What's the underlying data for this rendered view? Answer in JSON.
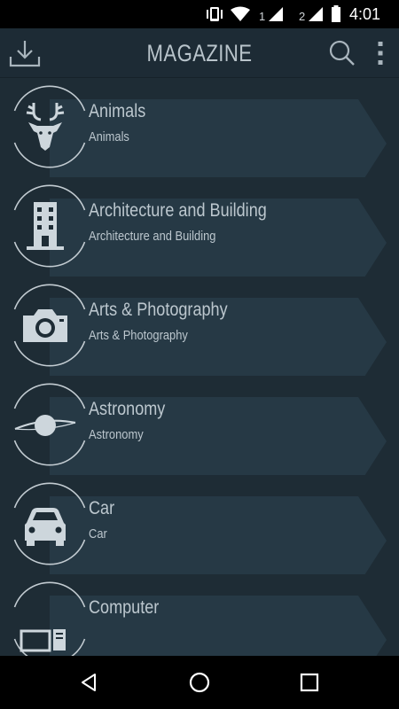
{
  "status_bar": {
    "time": "4:01",
    "sim1": "1",
    "sim2": "2",
    "icons": [
      "vibrate-icon",
      "wifi-icon",
      "signal-icon",
      "signal-icon",
      "battery-icon"
    ]
  },
  "toolbar": {
    "title": "MAGAZINE",
    "icons": [
      "download-icon",
      "search-icon",
      "more-vert-icon"
    ]
  },
  "categories": [
    {
      "title": "Animals",
      "subtitle": "Animals",
      "icon": "deer-icon"
    },
    {
      "title": "Architecture and Building",
      "subtitle": "Architecture and Building",
      "icon": "building-icon"
    },
    {
      "title": "Arts & Photography",
      "subtitle": "Arts & Photography",
      "icon": "camera-icon"
    },
    {
      "title": "Astronomy",
      "subtitle": "Astronomy",
      "icon": "planet-icon"
    },
    {
      "title": "Car",
      "subtitle": "Car",
      "icon": "car-icon"
    },
    {
      "title": "Computer",
      "subtitle": "",
      "icon": "computer-icon"
    }
  ],
  "nav_bar": {
    "icons": [
      "back-icon",
      "home-icon",
      "recents-icon"
    ]
  },
  "colors": {
    "toolbar_bg": "#1d2b35",
    "list_bg": "#1e2c35",
    "ribbon": "#263945",
    "text": "#bcc7ce",
    "icon": "#cdd6dc"
  }
}
